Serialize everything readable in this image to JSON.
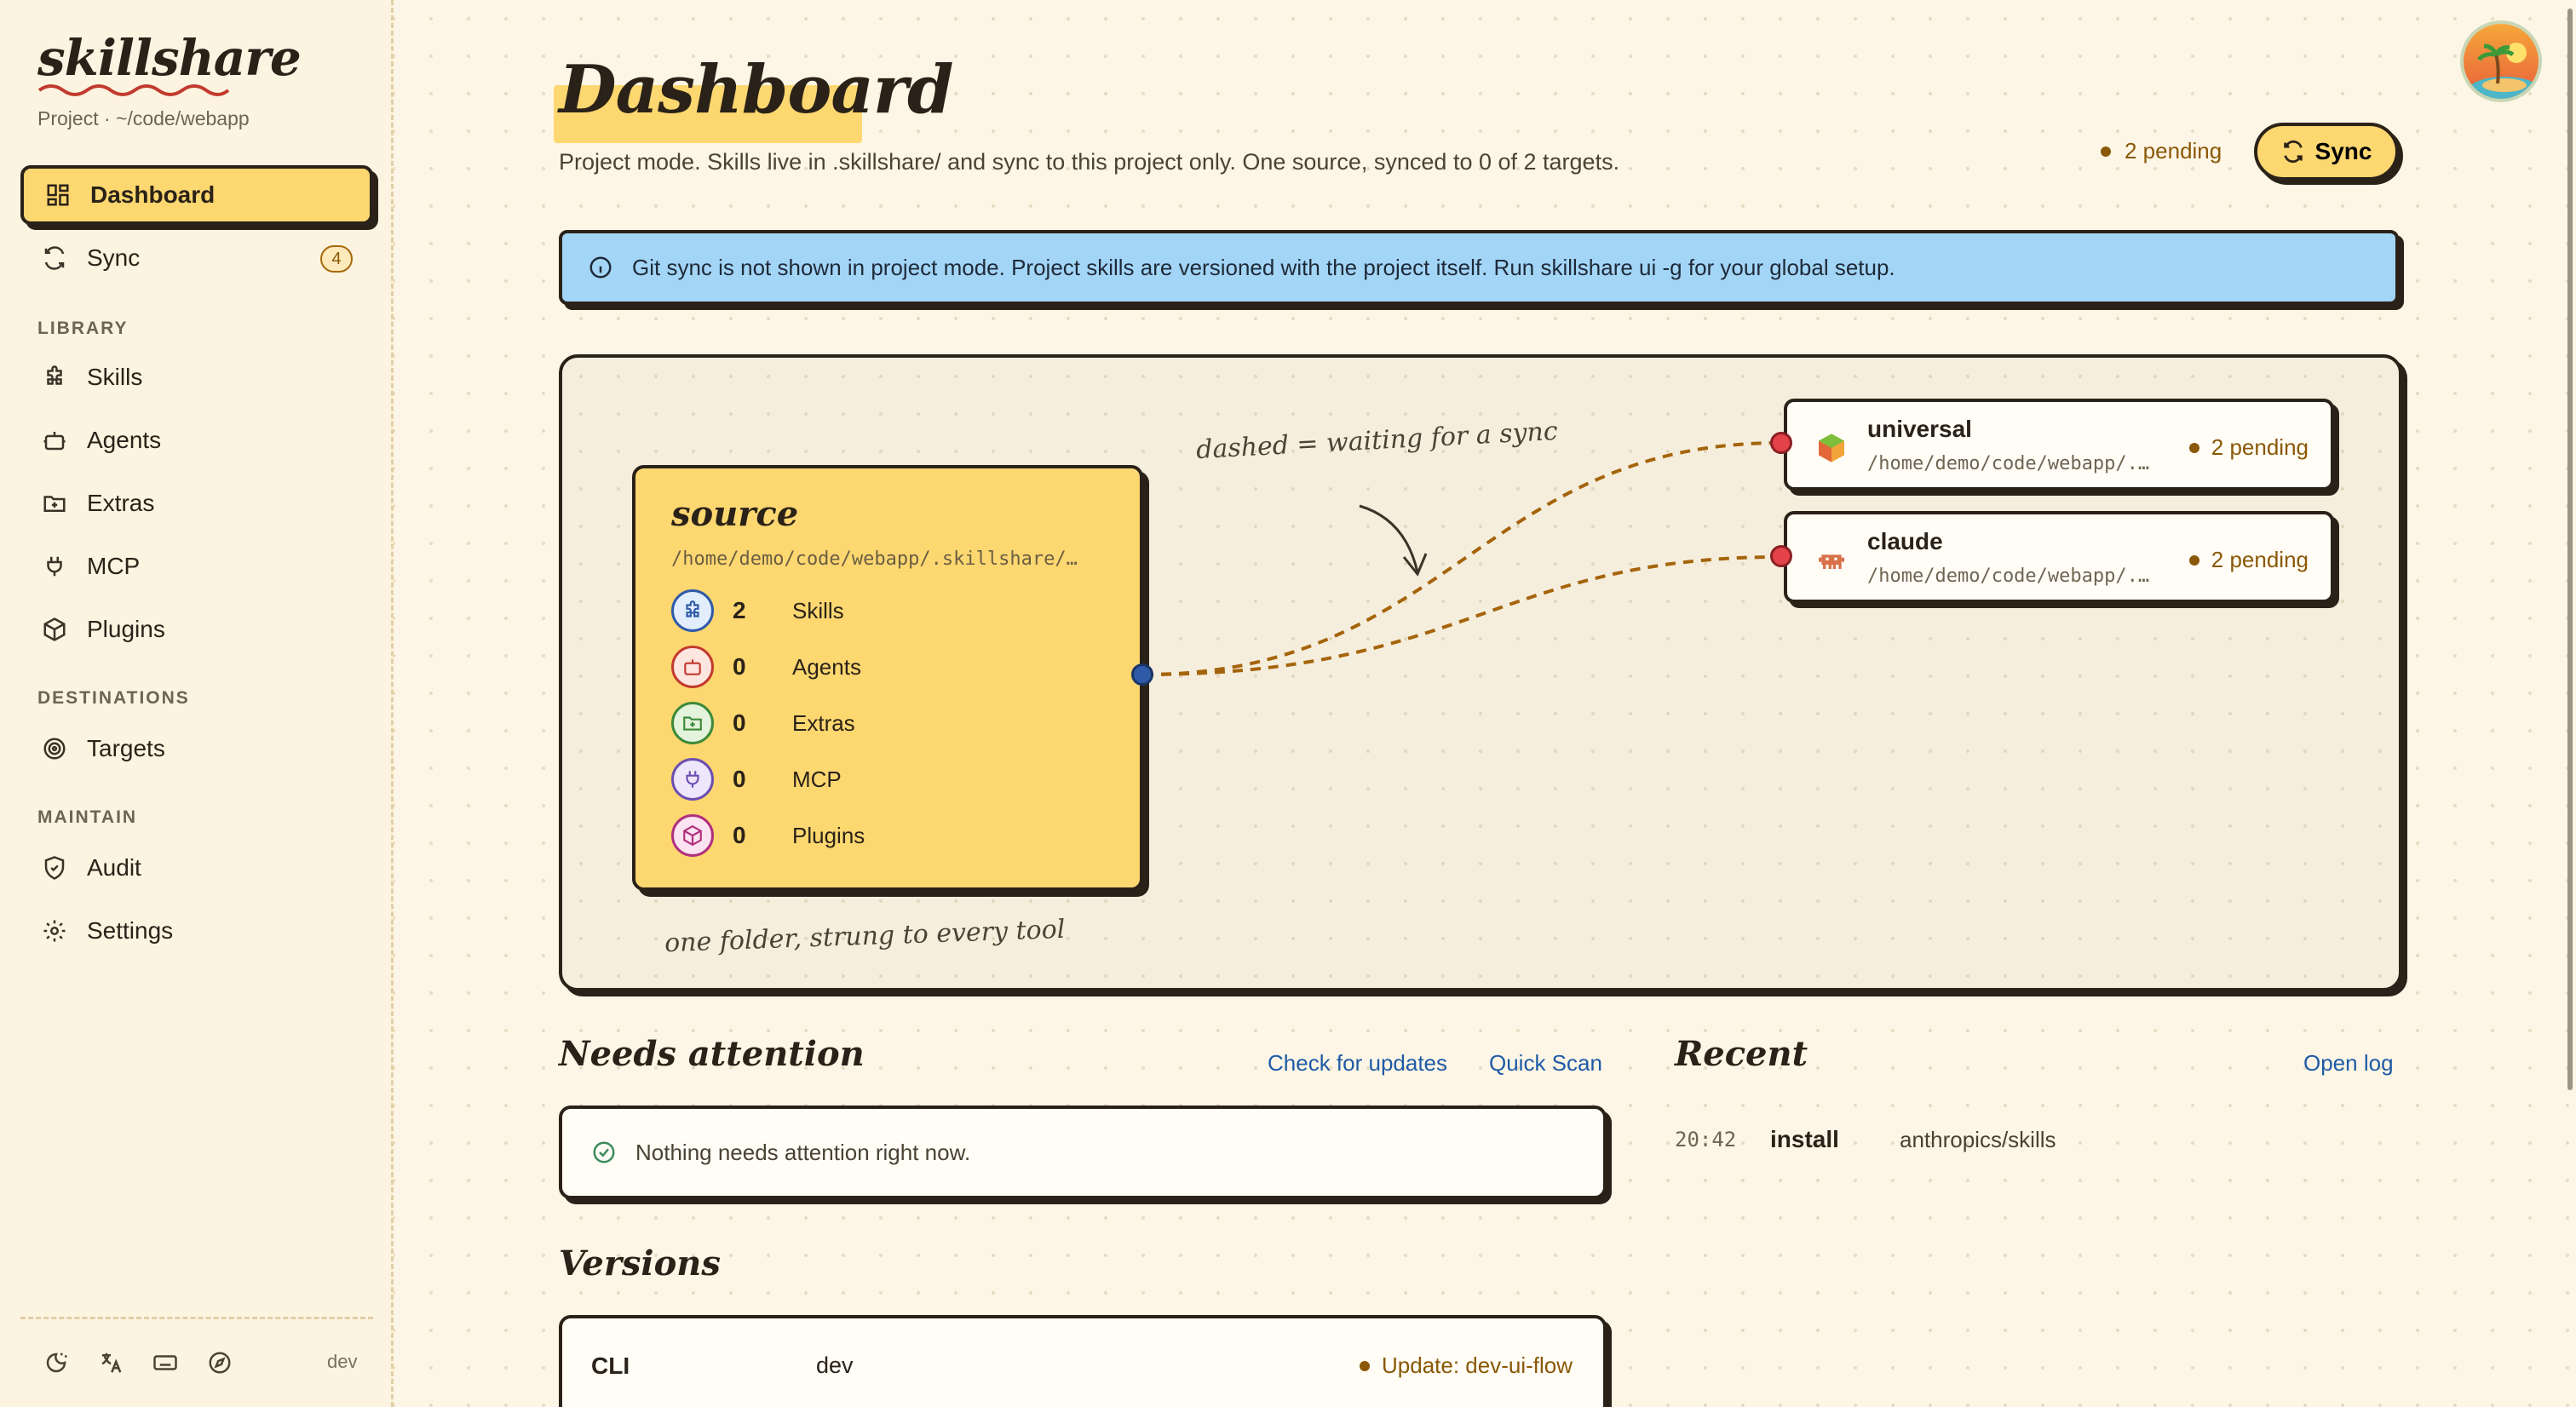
{
  "sidebar": {
    "logo": "skillshare",
    "project": "Project · ~/code/webapp",
    "items": {
      "dashboard": "Dashboard",
      "sync": "Sync",
      "sync_badge": "4",
      "skills": "Skills",
      "agents": "Agents",
      "extras": "Extras",
      "mcp": "MCP",
      "plugins": "Plugins",
      "targets": "Targets",
      "audit": "Audit",
      "settings": "Settings"
    },
    "sections": {
      "library": "LIBRARY",
      "destinations": "DESTINATIONS",
      "maintain": "MAINTAIN"
    },
    "footer": {
      "dev": "dev"
    }
  },
  "header": {
    "title": "Dashboard",
    "subtitle": "Project mode. Skills live in .skillshare/ and sync to this project only. One source, synced to 0 of 2 targets.",
    "pending": "2 pending",
    "sync_label": "Sync"
  },
  "info": {
    "text": "Git sync is not shown in project mode. Project skills are versioned with the project itself. Run skillshare ui -g for your global setup."
  },
  "diagram": {
    "note_top": "dashed = waiting for a sync",
    "note_bottom": "one folder, strung to every tool",
    "source": {
      "title": "source",
      "path": "/home/demo/code/webapp/.skillshare/…",
      "rows": [
        {
          "count": "2",
          "label": "Skills"
        },
        {
          "count": "0",
          "label": "Agents"
        },
        {
          "count": "0",
          "label": "Extras"
        },
        {
          "count": "0",
          "label": "MCP"
        },
        {
          "count": "0",
          "label": "Plugins"
        }
      ]
    },
    "targets": [
      {
        "name": "universal",
        "path": "/home/demo/code/webapp/.…",
        "status": "2 pending"
      },
      {
        "name": "claude",
        "path": "/home/demo/code/webapp/.…",
        "status": "2 pending"
      }
    ]
  },
  "attention": {
    "title": "Needs attention",
    "check_updates": "Check for updates",
    "quick_scan": "Quick Scan",
    "message": "Nothing needs attention right now."
  },
  "recent": {
    "title": "Recent",
    "open_log": "Open log",
    "entries": [
      {
        "time": "20:42",
        "action": "install",
        "subject": "anthropics/skills"
      }
    ]
  },
  "versions": {
    "title": "Versions",
    "rows": [
      {
        "name": "CLI",
        "version": "dev",
        "update": "Update: dev-ui-flow"
      }
    ]
  },
  "colors": {
    "accent": "#fdd770",
    "info": "#a3d5f7",
    "pending": "#8a5806",
    "link": "#1e5aa6",
    "ink": "#2a2218"
  }
}
